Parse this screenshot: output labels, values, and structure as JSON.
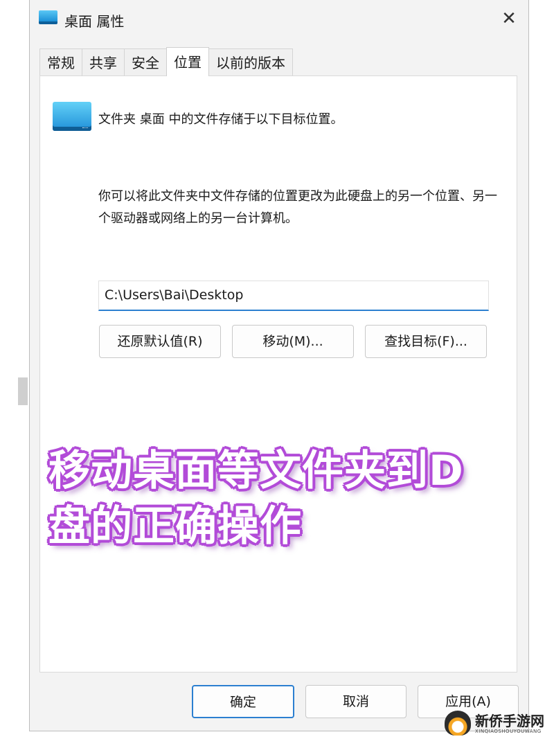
{
  "window": {
    "title": "桌面 属性",
    "close_glyph": "✕"
  },
  "tabs": [
    {
      "label": "常规",
      "active": false
    },
    {
      "label": "共享",
      "active": false
    },
    {
      "label": "安全",
      "active": false
    },
    {
      "label": "位置",
      "active": true
    },
    {
      "label": "以前的版本",
      "active": false
    }
  ],
  "location": {
    "intro": "文件夹 桌面 中的文件存储于以下目标位置。",
    "description": "你可以将此文件夹中文件存储的位置更改为此硬盘上的另一个位置、另一个驱动器或网络上的另一台计算机。",
    "path_value": "C:\\Users\\Bai\\Desktop",
    "restore_label": "还原默认值(R)",
    "move_label": "移动(M)...",
    "find_label": "查找目标(F)..."
  },
  "overlay": {
    "line1": "移动桌面等文件夹到D",
    "line2": "盘的正确操作"
  },
  "footer": {
    "ok_label": "确定",
    "cancel_label": "取消",
    "apply_label": "应用(A)"
  },
  "watermark": {
    "name": "新侨手游网",
    "sub": "XINQIAOSHOUYOUWANG"
  },
  "colors": {
    "accent": "#2b7fd0",
    "overlay_outline": "#b24bd8",
    "window_bg": "#f3f3f3"
  }
}
